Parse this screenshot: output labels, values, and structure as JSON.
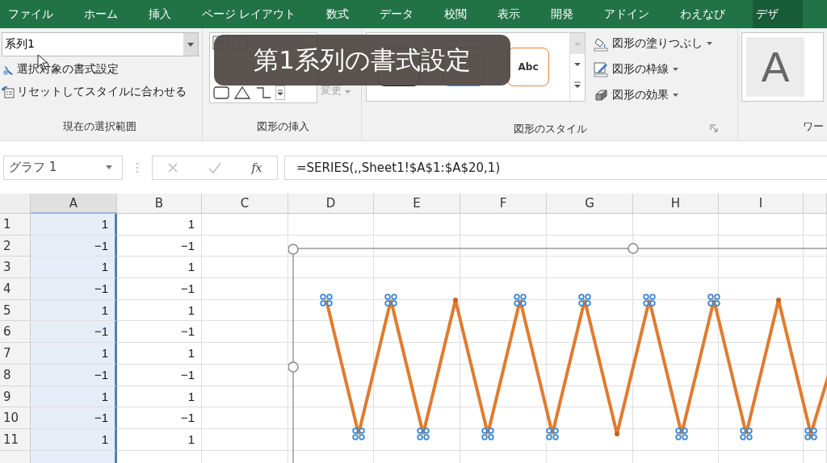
{
  "tabs": [
    {
      "label": "ファイル",
      "selected": false
    },
    {
      "label": "ホーム",
      "selected": false
    },
    {
      "label": "挿入",
      "selected": false
    },
    {
      "label": "ページ レイアウト",
      "selected": false
    },
    {
      "label": "数式",
      "selected": false
    },
    {
      "label": "データ",
      "selected": false
    },
    {
      "label": "校閲",
      "selected": false
    },
    {
      "label": "表示",
      "selected": false
    },
    {
      "label": "開発",
      "selected": false
    },
    {
      "label": "アドイン",
      "selected": false
    },
    {
      "label": "わえなび",
      "selected": false
    },
    {
      "label": "デザ",
      "selected": true
    }
  ],
  "ribbon": {
    "selection_group": {
      "dropdown_value": "系列1",
      "commands": [
        {
          "kind": "format",
          "label": "選択対象の書式設定"
        },
        {
          "kind": "reset",
          "label": "リセットしてスタイルに合わせる"
        }
      ],
      "label": "現在の選択範囲"
    },
    "insert_group": {
      "change_shape": {
        "label_lines": [
          "変更"
        ],
        "disabled": true
      },
      "label": "図形の挿入"
    },
    "styles_group": {
      "swatch": "Abc",
      "commands": [
        {
          "kind": "fill",
          "label": "図形の塗りつぶし"
        },
        {
          "kind": "outline",
          "label": "図形の枠線"
        },
        {
          "kind": "effect",
          "label": "図形の効果"
        }
      ],
      "label": "図形のスタイル"
    },
    "wordart_group": {
      "sample": "A",
      "label": "ワー"
    }
  },
  "tooltip": "第1系列の書式設定",
  "formula_bar": {
    "name_box": "グラフ 1",
    "fx": "fx",
    "formula": "=SERIES(,,Sheet1!$A$1:$A$20,1)"
  },
  "sheet": {
    "columns": [
      {
        "label": "A",
        "selected": true
      },
      {
        "label": "B",
        "selected": false
      },
      {
        "label": "C",
        "selected": false
      },
      {
        "label": "D",
        "selected": false
      },
      {
        "label": "E",
        "selected": false
      },
      {
        "label": "F",
        "selected": false
      },
      {
        "label": "G",
        "selected": false
      },
      {
        "label": "H",
        "selected": false
      },
      {
        "label": "I",
        "selected": false
      }
    ],
    "rows": [
      {
        "number": "1",
        "cells": [
          "1",
          "1"
        ]
      },
      {
        "number": "2",
        "cells": [
          "−1",
          "−1"
        ]
      },
      {
        "number": "3",
        "cells": [
          "1",
          "1"
        ]
      },
      {
        "number": "4",
        "cells": [
          "−1",
          "−1"
        ]
      },
      {
        "number": "5",
        "cells": [
          "1",
          "1"
        ]
      },
      {
        "number": "6",
        "cells": [
          "−1",
          "−1"
        ]
      },
      {
        "number": "7",
        "cells": [
          "1",
          "1"
        ]
      },
      {
        "number": "8",
        "cells": [
          "−1",
          "−1"
        ]
      },
      {
        "number": "9",
        "cells": [
          "1",
          "1"
        ]
      },
      {
        "number": "10",
        "cells": [
          "−1",
          "−1"
        ]
      },
      {
        "number": "11",
        "cells": [
          "1",
          "1"
        ]
      }
    ]
  },
  "chart": {
    "points": [
      {
        "selected": true
      },
      {
        "selected": true
      },
      {
        "selected": true
      },
      {
        "selected": true
      },
      {
        "selected": false
      },
      {
        "selected": true
      },
      {
        "selected": true
      },
      {
        "selected": true
      },
      {
        "selected": true
      },
      {
        "selected": false
      },
      {
        "selected": true
      },
      {
        "selected": true
      },
      {
        "selected": true
      },
      {
        "selected": true
      },
      {
        "selected": false
      },
      {
        "selected": true
      }
    ]
  }
}
